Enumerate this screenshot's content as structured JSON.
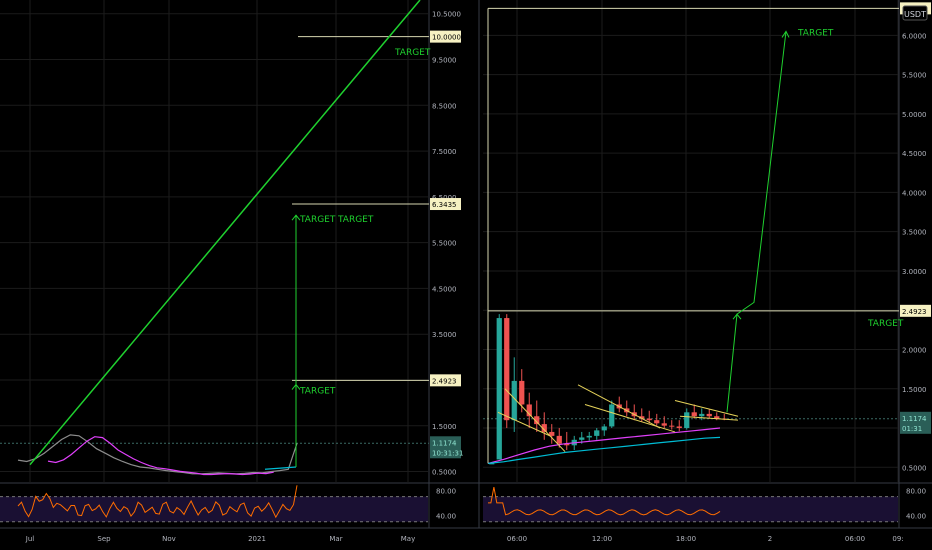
{
  "header": {
    "currency": "USDT"
  },
  "colors": {
    "background": "#000000",
    "grid": "#1b1b1b",
    "separator": "#363a45",
    "axis_text": "#b2b5be",
    "target": "#1fd12f",
    "hline": "#d6d6b0",
    "candle_up": "#26a69a",
    "candle_down": "#ef5350",
    "ma_magenta": "#e040fb",
    "ma_teal": "#00bcd4",
    "ma_green": "#4caf50",
    "rsi_line": "#ff6d00",
    "rsi_band": "#1a1033",
    "price_tag": "#f6f1c2",
    "last_price_tag": "#2a5e57",
    "last_price_text": "#8fe3d0"
  },
  "chart_data": [
    {
      "type": "line",
      "panel": "left",
      "x_ticks": [
        "Jul",
        "Sep",
        "Nov",
        "2021",
        "Mar",
        "May"
      ],
      "y_ticks": [
        0.5,
        1.5,
        2.5,
        3.5,
        4.5,
        5.5,
        6.5,
        7.5,
        8.5,
        9.5,
        10.5
      ],
      "y_tick_labels": [
        "0.5000",
        "1.5000",
        "2.5000",
        "3.5000",
        "4.5000",
        "5.5000",
        "6.5000",
        "7.5000",
        "8.5000",
        "9.5000",
        "10.5000"
      ],
      "ylim": [
        0.25,
        10.8
      ],
      "levels": [
        {
          "value": 10.0,
          "label": "10.0000"
        },
        {
          "value": 6.3435,
          "label": "6.3435"
        },
        {
          "value": 2.4923,
          "label": "2.4923"
        }
      ],
      "last_price": {
        "value": 1.1174,
        "label": "1.1174",
        "timer": "10:31:31"
      },
      "annotations": [
        {
          "text": "TARGET",
          "value": 9.6
        },
        {
          "text": "TARGET",
          "value": 5.95
        },
        {
          "text": "TARGET",
          "value": 5.95
        },
        {
          "text": "TARGET",
          "value": 2.2
        }
      ],
      "series": [
        {
          "kind": "price",
          "values": [
            0.75,
            0.72,
            0.78,
            0.9,
            1.05,
            1.2,
            1.3,
            1.28,
            1.15,
            1.0,
            0.9,
            0.8,
            0.72,
            0.65,
            0.6,
            0.58,
            0.55,
            0.52,
            0.5,
            0.48,
            0.45,
            0.45,
            0.46,
            0.47,
            0.46,
            0.45,
            0.46,
            0.48,
            0.47,
            0.5,
            0.52,
            0.55,
            1.1174
          ]
        }
      ],
      "rsi": {
        "y_ticks": [
          40,
          80
        ],
        "y_tick_labels": [
          "40.00",
          "80.00"
        ],
        "band": [
          30,
          70
        ]
      }
    },
    {
      "type": "candlestick",
      "panel": "right",
      "x_ticks": [
        "06:00",
        "12:00",
        "18:00",
        "2",
        "06:00",
        "09:"
      ],
      "y_ticks": [
        0.5,
        1.0,
        1.5,
        2.0,
        2.5,
        3.0,
        3.5,
        4.0,
        4.5,
        5.0,
        5.5,
        6.0
      ],
      "y_tick_labels": [
        "0.5000",
        "1.0000",
        "1.5000",
        "2.0000",
        "2.5000",
        "3.0000",
        "3.5000",
        "4.0000",
        "4.5000",
        "5.0000",
        "5.5000",
        "6.0000"
      ],
      "ylim": [
        0.3,
        6.45
      ],
      "levels": [
        {
          "value": 6.3435,
          "label": "6.3435"
        },
        {
          "value": 2.4923,
          "label": "2.4923"
        }
      ],
      "last_price": {
        "value": 1.1174,
        "label": "1.1174",
        "timer": "01:31"
      },
      "annotations": [
        {
          "text": "TARGET",
          "value": 6.0
        },
        {
          "text": "TARGET",
          "value": 2.3
        }
      ],
      "candles": [
        [
          0.55,
          0.55,
          0.55,
          0.55
        ],
        [
          0.6,
          2.45,
          0.6,
          2.4
        ],
        [
          2.4,
          2.45,
          1.0,
          1.1
        ],
        [
          1.1,
          1.9,
          0.95,
          1.6
        ],
        [
          1.6,
          1.75,
          1.2,
          1.3
        ],
        [
          1.3,
          1.45,
          1.0,
          1.15
        ],
        [
          1.15,
          1.35,
          0.95,
          1.05
        ],
        [
          1.05,
          1.2,
          0.85,
          0.95
        ],
        [
          0.95,
          1.05,
          0.8,
          0.9
        ],
        [
          0.9,
          1.0,
          0.75,
          0.8
        ],
        [
          0.8,
          0.95,
          0.72,
          0.78
        ],
        [
          0.78,
          0.9,
          0.72,
          0.85
        ],
        [
          0.85,
          0.95,
          0.8,
          0.88
        ],
        [
          0.88,
          0.95,
          0.84,
          0.9
        ],
        [
          0.9,
          1.0,
          0.85,
          0.97
        ],
        [
          0.97,
          1.05,
          0.9,
          1.02
        ],
        [
          1.02,
          1.35,
          1.0,
          1.3
        ],
        [
          1.3,
          1.4,
          1.2,
          1.25
        ],
        [
          1.25,
          1.35,
          1.15,
          1.2
        ],
        [
          1.2,
          1.3,
          1.1,
          1.15
        ],
        [
          1.15,
          1.25,
          1.08,
          1.12
        ],
        [
          1.12,
          1.22,
          1.06,
          1.1
        ],
        [
          1.1,
          1.18,
          1.03,
          1.06
        ],
        [
          1.06,
          1.15,
          1.0,
          1.03
        ],
        [
          1.03,
          1.1,
          0.98,
          1.02
        ],
        [
          1.02,
          1.1,
          0.96,
          1.0
        ],
        [
          1.0,
          1.25,
          0.98,
          1.2
        ],
        [
          1.2,
          1.3,
          1.12,
          1.15
        ],
        [
          1.15,
          1.25,
          1.1,
          1.18
        ],
        [
          1.18,
          1.24,
          1.12,
          1.15
        ],
        [
          1.15,
          1.2,
          1.1,
          1.12
        ],
        [
          1.12,
          1.18,
          1.1,
          1.1174
        ]
      ],
      "series": [
        {
          "kind": "ma",
          "color_key": "ma_magenta",
          "values": [
            0.55,
            0.6,
            0.66,
            0.72,
            0.77,
            0.8,
            0.82,
            0.84,
            0.86,
            0.88,
            0.9,
            0.92,
            0.94,
            0.96,
            0.98,
            1.0
          ]
        },
        {
          "kind": "ma",
          "color_key": "ma_teal",
          "values": [
            0.55,
            0.57,
            0.6,
            0.63,
            0.66,
            0.69,
            0.71,
            0.73,
            0.75,
            0.77,
            0.79,
            0.81,
            0.83,
            0.85,
            0.87,
            0.88
          ]
        }
      ],
      "rsi": {
        "y_ticks": [
          40,
          80
        ],
        "y_tick_labels": [
          "40.00",
          "80.00"
        ],
        "band": [
          30,
          70
        ]
      }
    }
  ]
}
